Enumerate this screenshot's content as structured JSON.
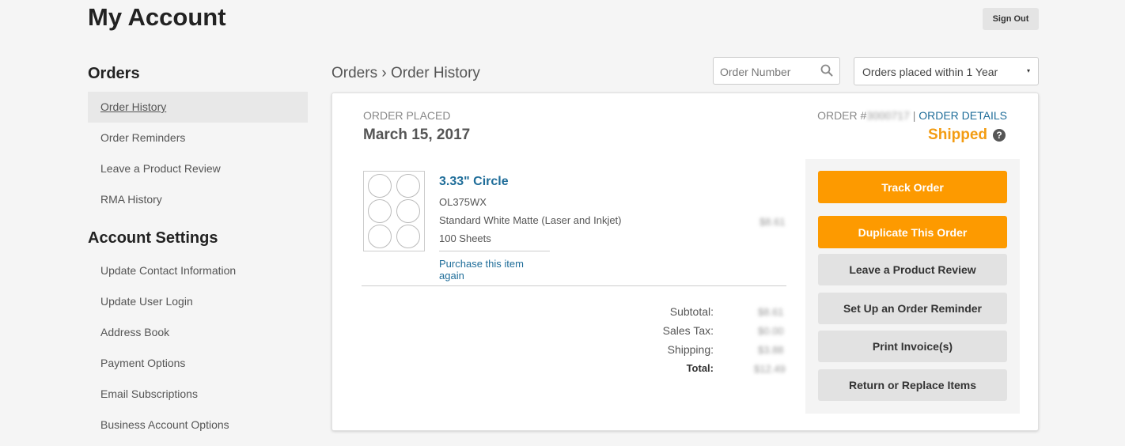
{
  "header": {
    "title": "My Account",
    "sign_out_label": "Sign Out"
  },
  "sidebar": {
    "orders_heading": "Orders",
    "orders_items": [
      {
        "label": "Order History",
        "active": true
      },
      {
        "label": "Order Reminders"
      },
      {
        "label": "Leave a Product Review"
      },
      {
        "label": "RMA History"
      }
    ],
    "settings_heading": "Account Settings",
    "settings_items": [
      {
        "label": "Update Contact Information"
      },
      {
        "label": "Update User Login"
      },
      {
        "label": "Address Book"
      },
      {
        "label": "Payment Options"
      },
      {
        "label": "Email Subscriptions"
      },
      {
        "label": "Business Account Options"
      }
    ]
  },
  "toolbar": {
    "breadcrumb_root": "Orders",
    "breadcrumb_sep": "›",
    "breadcrumb_current": "Order History",
    "search_placeholder": "Order Number",
    "search_icon": "search-icon",
    "filter_value": "Orders placed within 1 Year",
    "filter_caret": "▾"
  },
  "order": {
    "placed_label": "ORDER PLACED",
    "placed_date": "March 15, 2017",
    "number_prefix": "ORDER #",
    "number_redacted": "3000717",
    "separator": "|",
    "details_link": "ORDER DETAILS",
    "status": "Shipped",
    "status_color": "#f39c12",
    "help_glyph": "?",
    "item": {
      "name": "3.33\" Circle",
      "sku": "OL375WX",
      "material": "Standard White Matte (Laser and Inkjet)",
      "quantity": "100 Sheets",
      "price_redacted": "$8.61",
      "purchase_again": "Purchase this item again"
    },
    "totals": [
      {
        "label": "Subtotal:",
        "value": "$8.61"
      },
      {
        "label": "Sales Tax:",
        "value": "$0.00"
      },
      {
        "label": "Shipping:",
        "value": "$3.88"
      },
      {
        "label": "Total:",
        "value": "$12.49",
        "bold": true
      }
    ]
  },
  "actions": {
    "track": "Track Order",
    "duplicate": "Duplicate This Order",
    "review": "Leave a Product Review",
    "reminder": "Set Up an Order Reminder",
    "invoice": "Print Invoice(s)",
    "return": "Return or Replace Items",
    "accent": "#fd9a00"
  }
}
